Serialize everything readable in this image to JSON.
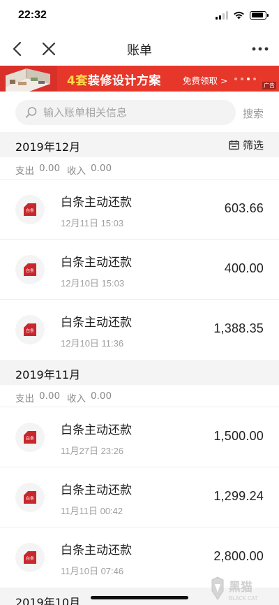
{
  "status_bar": {
    "time": "22:32"
  },
  "nav": {
    "title": "账单"
  },
  "ad": {
    "highlight": "4套",
    "text": "装修设计方案",
    "cta": "免费领取 >",
    "tag": "广告",
    "brand_color": "#e6372a"
  },
  "search": {
    "placeholder": "输入账单相关信息",
    "button": "搜索"
  },
  "months": [
    {
      "title": "2019年12月",
      "filter_label": "筛选",
      "expense_label": "支出",
      "expense_value": "0.00",
      "income_label": "收入",
      "income_value": "0.00",
      "transactions": [
        {
          "icon_text": "白条",
          "name": "白条主动还款",
          "time": "12月11日 15:03",
          "amount": "603.66"
        },
        {
          "icon_text": "白条",
          "name": "白条主动还款",
          "time": "12月10日 15:03",
          "amount": "400.00"
        },
        {
          "icon_text": "白条",
          "name": "白条主动还款",
          "time": "12月10日 11:36",
          "amount": "1,388.35"
        }
      ]
    },
    {
      "title": "2019年11月",
      "expense_label": "支出",
      "expense_value": "0.00",
      "income_label": "收入",
      "income_value": "0.00",
      "transactions": [
        {
          "icon_text": "白条",
          "name": "白条主动还款",
          "time": "11月27日 23:26",
          "amount": "1,500.00"
        },
        {
          "icon_text": "白条",
          "name": "白条主动还款",
          "time": "11月11日 00:42",
          "amount": "1,299.24"
        },
        {
          "icon_text": "白条",
          "name": "白条主动还款",
          "time": "11月10日 07:46",
          "amount": "2,800.00"
        }
      ]
    },
    {
      "title": "2019年10月"
    }
  ],
  "watermark": {
    "text": "黑猫",
    "subtext": "BLACK CAT"
  },
  "colors": {
    "accent_red": "#c8272d",
    "background_gray": "#f4f4f4"
  }
}
